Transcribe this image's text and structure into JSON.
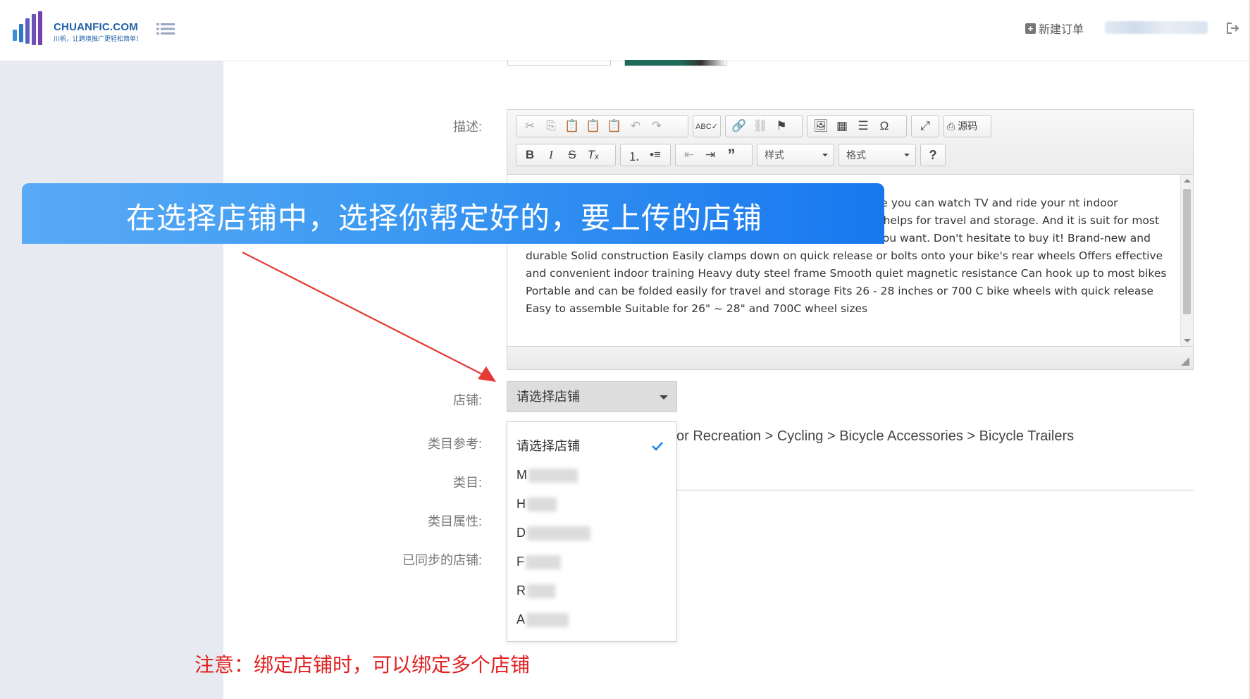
{
  "header": {
    "logo_title": "CHUANFIC.COM",
    "logo_slogan": "川帆，让跨境推广更轻松简单！",
    "new_order_label": "新建订单"
  },
  "form": {
    "desc_label": "描述:",
    "store_label": "店铺:",
    "category_ref_label": "类目参考:",
    "category_label": "类目:",
    "category_attr_label": "类目属性:",
    "synced_store_label": "已同步的店铺:",
    "category_ref_value": "or Recreation > Cycling > Bicycle Accessories > Bicycle Trailers"
  },
  "editor": {
    "source_label": "源码",
    "style_select": "样式",
    "format_select": "格式",
    "help_label": "?",
    "content": "for an outdoor ride then this item is perfect for tside. What's more you can watch TV and ride your nt indoor training. Besides it has portable feature and can be folded easily helps for travel and storage. And it is suit for most bikes. With it you will love the riding exercise and do it anytime you want.   Don't hesitate to buy it!   Brand-new and durable Solid construction Easily clamps down on quick release or bolts onto your bike's rear wheels Offers effective and convenient indoor training Heavy duty steel frame Smooth quiet magnetic resistance Can hook up to most bikes Portable and can be folded easily for travel and storage Fits 26 - 28 inches or 700 C bike wheels with quick release Easy to assemble Suitable for 26\" ~ 28\"  and 700C wheel sizes"
  },
  "store_select": {
    "selected": "请选择店铺",
    "options": [
      {
        "label": "请选择店铺"
      },
      {
        "label": "M"
      },
      {
        "label": "H"
      },
      {
        "label": "D"
      },
      {
        "label": "F"
      },
      {
        "label": "R"
      },
      {
        "label": "A"
      }
    ]
  },
  "overlay": {
    "banner_text": "在选择店铺中，选择你帮定好的，要上传的店铺",
    "note_text": "注意：绑定店铺时，可以绑定多个店铺"
  },
  "colors": {
    "banner_start": "#5aaaf5",
    "banner_end": "#1877ef",
    "arrow": "#e53935",
    "note": "#e02020",
    "check": "#1e88e5"
  }
}
